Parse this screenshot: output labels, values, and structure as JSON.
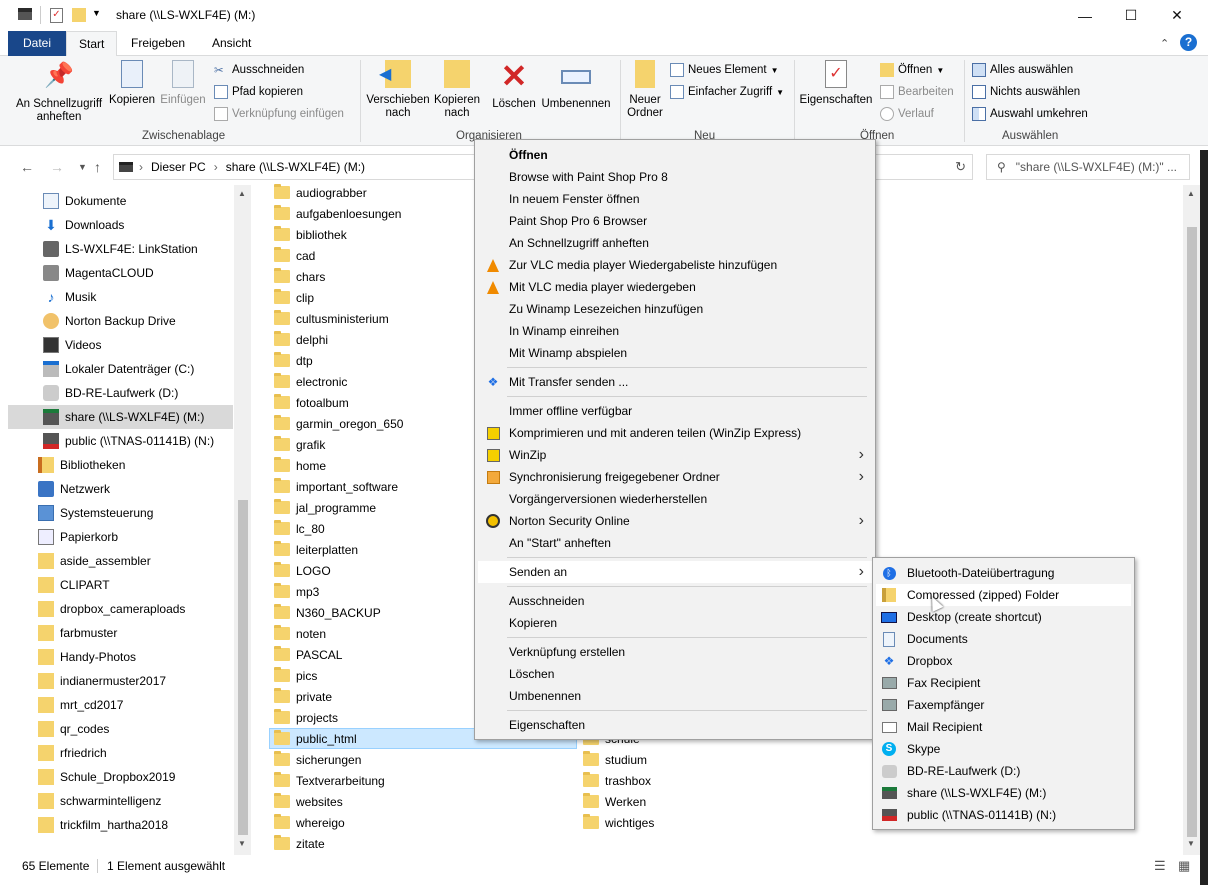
{
  "window": {
    "title": "share (\\\\LS-WXLF4E) (M:)",
    "minimize_glyph": "—",
    "maximize_glyph": "☐",
    "close_glyph": "✕"
  },
  "ribbon_tabs": [
    "Datei",
    "Start",
    "Freigeben",
    "Ansicht"
  ],
  "ribbon": {
    "clipboard": {
      "pin": "An Schnellzugriff anheften",
      "copy": "Kopieren",
      "paste": "Einfügen",
      "cut": "Ausschneiden",
      "copy_path": "Pfad kopieren",
      "paste_shortcut": "Verknüpfung einfügen",
      "group": "Zwischenablage"
    },
    "organize": {
      "move": "Verschieben nach",
      "copy_to": "Kopieren nach",
      "delete": "Löschen",
      "rename": "Umbenennen",
      "group": "Organisieren"
    },
    "new": {
      "new_folder": "Neuer Ordner",
      "new_item": "Neues Element",
      "easy_access": "Einfacher Zugriff",
      "group": "Neu"
    },
    "open": {
      "properties": "Eigenschaften",
      "open": "Öffnen",
      "edit": "Bearbeiten",
      "history": "Verlauf",
      "group": "Öffnen"
    },
    "select": {
      "select_all": "Alles auswählen",
      "select_none": "Nichts auswählen",
      "invert": "Auswahl umkehren",
      "group": "Auswählen"
    }
  },
  "address": {
    "crumbs": [
      "Dieser PC",
      "share (\\\\LS-WXLF4E) (M:)"
    ],
    "search_placeholder": "\"share (\\\\LS-WXLF4E) (M:)\" ..."
  },
  "nav_pane": [
    {
      "label": "Dokumente",
      "icon": "documents-icon"
    },
    {
      "label": "Downloads",
      "icon": "downloads-icon"
    },
    {
      "label": "LS-WXLF4E: LinkStation",
      "icon": "nas-icon"
    },
    {
      "label": "MagentaCLOUD",
      "icon": "cloud-icon"
    },
    {
      "label": "Musik",
      "icon": "music-icon"
    },
    {
      "label": "Norton Backup Drive",
      "icon": "backup-drive-icon"
    },
    {
      "label": "Videos",
      "icon": "videos-icon"
    },
    {
      "label": "Lokaler Datenträger (C:)",
      "icon": "disk-icon"
    },
    {
      "label": "BD-RE-Laufwerk (D:)",
      "icon": "optical-drive-icon"
    },
    {
      "label": "share (\\\\LS-WXLF4E) (M:)",
      "icon": "network-drive-icon"
    },
    {
      "label": "public (\\\\TNAS-01141B) (N:)",
      "icon": "disconnected-drive-icon"
    },
    {
      "label": "Bibliotheken",
      "icon": "libraries-icon"
    },
    {
      "label": "Netzwerk",
      "icon": "network-icon"
    },
    {
      "label": "Systemsteuerung",
      "icon": "control-panel-icon"
    },
    {
      "label": "Papierkorb",
      "icon": "recycle-bin-icon"
    },
    {
      "label": "aside_assembler",
      "icon": "folder-icon"
    },
    {
      "label": "CLIPART",
      "icon": "folder-icon"
    },
    {
      "label": "dropbox_cameraploads",
      "icon": "folder-icon"
    },
    {
      "label": "farbmuster",
      "icon": "folder-icon"
    },
    {
      "label": "Handy-Photos",
      "icon": "folder-icon"
    },
    {
      "label": "indianermuster2017",
      "icon": "folder-icon"
    },
    {
      "label": "mrt_cd2017",
      "icon": "folder-icon"
    },
    {
      "label": "qr_codes",
      "icon": "folder-icon"
    },
    {
      "label": "rfriedrich",
      "icon": "folder-icon"
    },
    {
      "label": "Schule_Dropbox2019",
      "icon": "folder-icon"
    },
    {
      "label": "schwarmintelligenz",
      "icon": "folder-icon"
    },
    {
      "label": "trickfilm_hartha2018",
      "icon": "folder-icon"
    }
  ],
  "files_col1": [
    "audiograbber",
    "aufgabenloesungen",
    "bibliothek",
    "cad",
    "chars",
    "clip",
    "cultusministerium",
    "delphi",
    "dtp",
    "electronic",
    "fotoalbum",
    "garmin_oregon_650",
    "grafik",
    "home",
    "important_software",
    "jal_programme",
    "lc_80",
    "leiterplatten",
    "LOGO",
    "mp3",
    "N360_BACKUP",
    "noten",
    "PASCAL",
    "pics",
    "private",
    "projects",
    "public_html",
    "sicherungen",
    "Textverarbeitung",
    "websites",
    "whereigo",
    "zitate"
  ],
  "files_col2": [
    "schule",
    "studium",
    "trashbox",
    "Werken",
    "wichtiges"
  ],
  "status": {
    "count": "65 Elemente",
    "selected": "1 Element ausgewählt"
  },
  "context_menu": [
    {
      "label": "Öffnen",
      "bold": true
    },
    {
      "label": "Browse with Paint Shop Pro 8"
    },
    {
      "label": "In neuem Fenster öffnen"
    },
    {
      "label": "Paint Shop Pro 6 Browser"
    },
    {
      "label": "An Schnellzugriff anheften"
    },
    {
      "label": "Zur VLC media player Wiedergabeliste hinzufügen",
      "icon": "vlc-icon"
    },
    {
      "label": "Mit VLC media player wiedergeben",
      "icon": "vlc-icon"
    },
    {
      "label": "Zu Winamp Lesezeichen hinzufügen"
    },
    {
      "label": "In Winamp einreihen"
    },
    {
      "label": "Mit Winamp abspielen"
    },
    {
      "label": "Mit Transfer senden ...",
      "icon": "dropbox-icon"
    },
    {
      "label": "Immer offline verfügbar"
    },
    {
      "label": "Komprimieren und mit anderen teilen (WinZip Express)",
      "icon": "winzip-icon"
    },
    {
      "label": "WinZip",
      "icon": "winzip-icon",
      "sub": true
    },
    {
      "label": "Synchronisierung freigegebener Ordner",
      "icon": "sync-icon",
      "sub": true
    },
    {
      "label": "Vorgängerversionen wiederherstellen"
    },
    {
      "label": "Norton Security Online",
      "icon": "norton-icon",
      "sub": true
    },
    {
      "label": "An \"Start\" anheften"
    },
    {
      "label": "Senden an",
      "sub": true,
      "hl": true
    },
    {
      "label": "Ausschneiden"
    },
    {
      "label": "Kopieren"
    },
    {
      "label": "Verknüpfung erstellen"
    },
    {
      "label": "Löschen"
    },
    {
      "label": "Umbenennen"
    },
    {
      "label": "Eigenschaften"
    }
  ],
  "send_to": [
    {
      "label": "Bluetooth-Dateiübertragung",
      "icon": "bluetooth-icon"
    },
    {
      "label": "Compressed (zipped) Folder",
      "icon": "zip-folder-icon",
      "hl": true
    },
    {
      "label": "Desktop (create shortcut)",
      "icon": "desktop-icon"
    },
    {
      "label": "Documents",
      "icon": "documents-icon"
    },
    {
      "label": "Dropbox",
      "icon": "dropbox-icon"
    },
    {
      "label": "Fax Recipient",
      "icon": "fax-icon"
    },
    {
      "label": "Faxempfänger",
      "icon": "fax-icon"
    },
    {
      "label": "Mail Recipient",
      "icon": "mail-icon"
    },
    {
      "label": "Skype",
      "icon": "skype-icon"
    },
    {
      "label": "BD-RE-Laufwerk (D:)",
      "icon": "optical-drive-icon"
    },
    {
      "label": "share (\\\\LS-WXLF4E) (M:)",
      "icon": "network-drive-icon"
    },
    {
      "label": "public (\\\\TNAS-01141B) (N:)",
      "icon": "disconnected-drive-icon"
    }
  ]
}
